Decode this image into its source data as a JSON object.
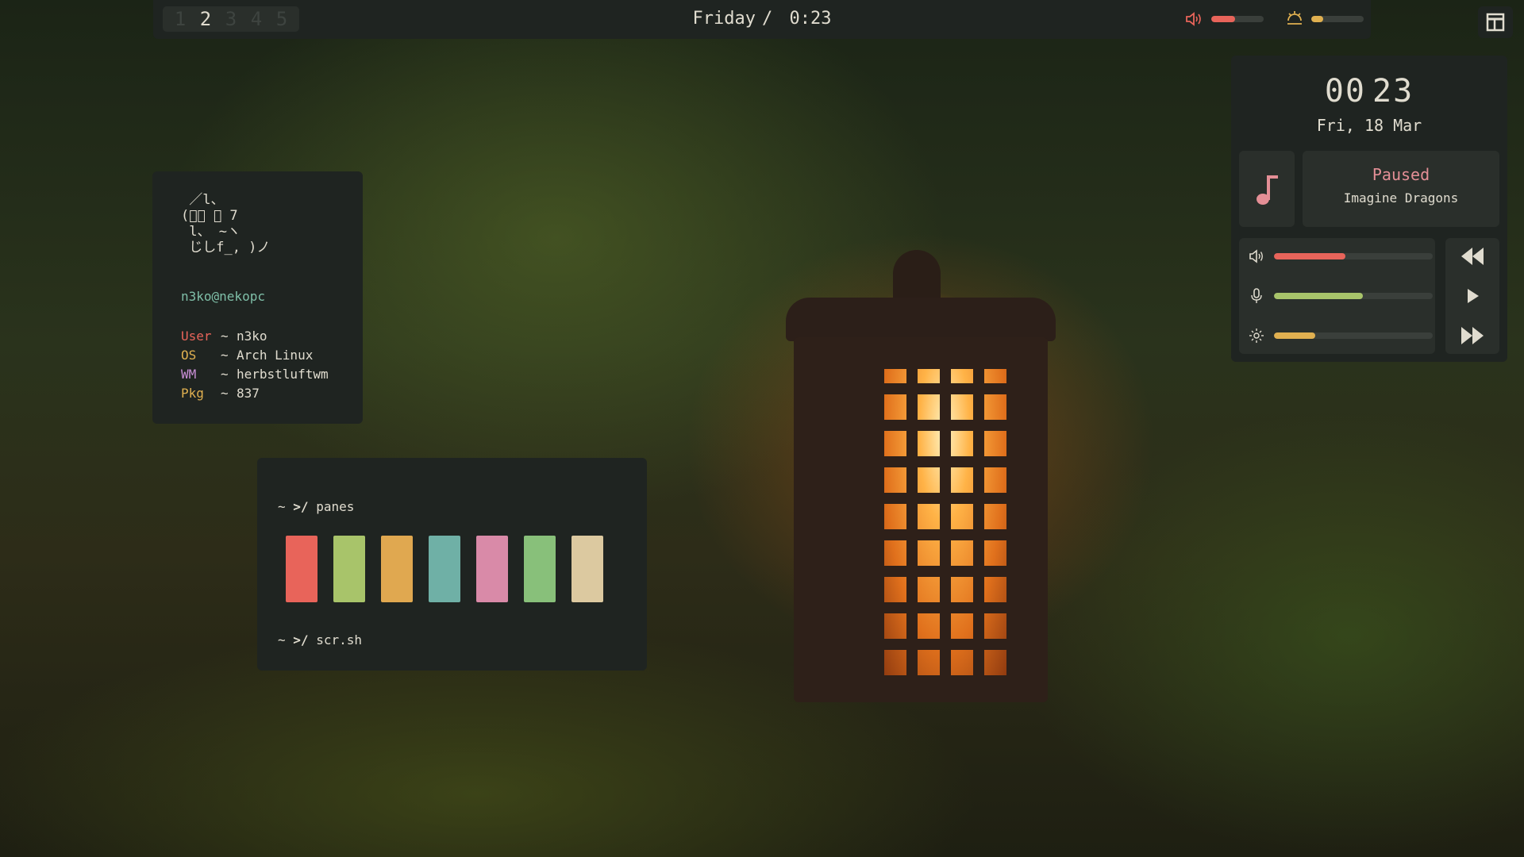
{
  "topbar": {
    "workspaces": [
      "1",
      "2",
      "3",
      "4",
      "5"
    ],
    "active_workspace": "2",
    "day": "Friday",
    "separator": "/",
    "time": "0:23",
    "volume_level": 0.45,
    "brightness_level": 0.22,
    "volume_color": "#e8645a",
    "brightness_color": "#e0b050"
  },
  "fetch": {
    "ascii_art": " ／l、\n(ﾟ､ ｡ 7\n l、 ~ヽ\n じしf_, )ノ",
    "host": "n3ko@nekopc",
    "rows": [
      {
        "key": "User",
        "sep": "~",
        "value": "n3ko",
        "color": "#e8645a"
      },
      {
        "key": "OS",
        "sep": "~",
        "value": "Arch Linux",
        "color": "#e0b050"
      },
      {
        "key": "WM",
        "sep": "~",
        "value": "herbstluftwm",
        "color": "#c98fd6"
      },
      {
        "key": "Pkg",
        "sep": "~",
        "value": "837",
        "color": "#e0b050"
      }
    ]
  },
  "panes": {
    "prompt1_tilde": "~",
    "prompt1_arrow": ">/",
    "prompt1_cmd": "panes",
    "prompt2_tilde": "~",
    "prompt2_arrow": ">/",
    "prompt2_cmd": "scr.sh",
    "colors": [
      "#e8645a",
      "#a8c46a",
      "#e0a850",
      "#6fb0a6",
      "#d98aa8",
      "#88c07a",
      "#dcc9a0"
    ]
  },
  "widget": {
    "hour": "00",
    "minute": "23",
    "date": "Fri, 18 Mar",
    "music_status": "Paused",
    "music_artist": "Imagine Dragons",
    "volume_level": 0.45,
    "mic_level": 0.56,
    "brightness_level": 0.26,
    "volume_color": "#e8645a",
    "mic_color": "#a8c46a",
    "brightness_color": "#e0b050",
    "music_icon_color": "#e48f96"
  }
}
